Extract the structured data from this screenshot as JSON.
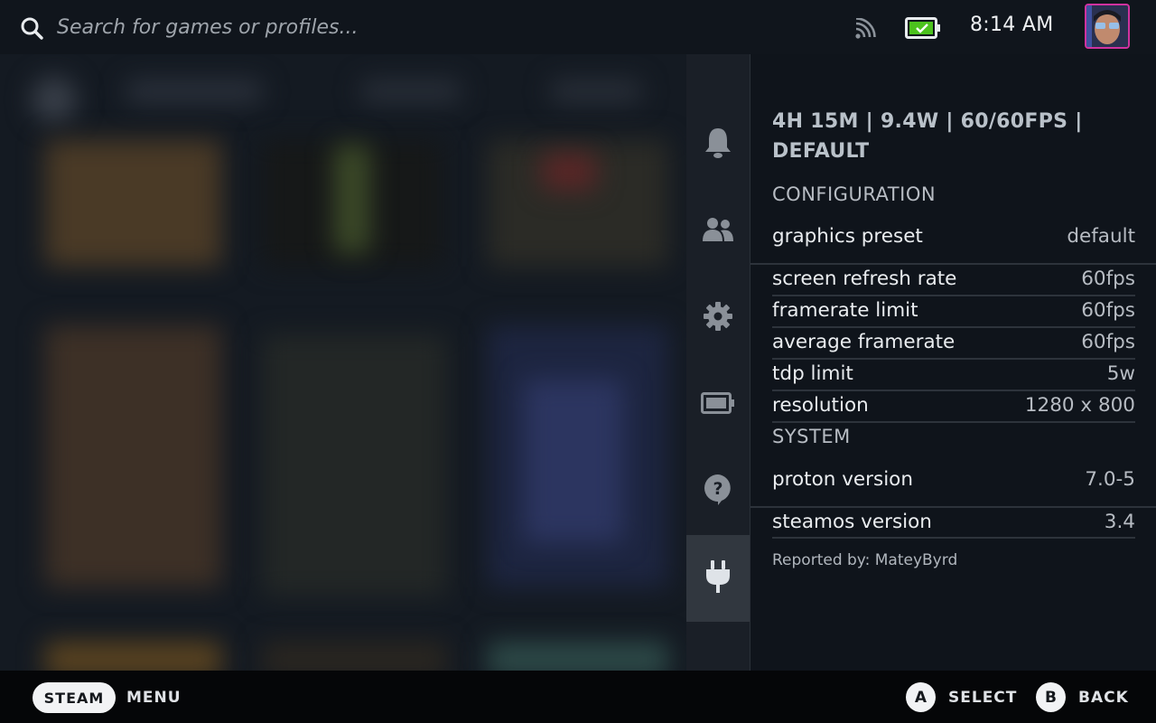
{
  "search": {
    "placeholder": "Search for games or profiles..."
  },
  "status": {
    "clock": "8:14 AM"
  },
  "icons": {
    "search": "search-icon",
    "cast": "rss-icon",
    "battery": "battery-charging-icon",
    "tabs": [
      "bell-icon",
      "friends-icon",
      "gear-icon",
      "battery-icon",
      "help-icon",
      "plug-icon"
    ]
  },
  "panel": {
    "summary": "4H 15M | 9.4W | 60/60FPS | DEFAULT",
    "configuration_header": "CONFIGURATION",
    "configuration": [
      {
        "label": "graphics preset",
        "value": "default"
      },
      {
        "label": "screen refresh rate",
        "value": "60fps"
      },
      {
        "label": "framerate limit",
        "value": "60fps"
      },
      {
        "label": "average framerate",
        "value": "60fps"
      },
      {
        "label": "tdp limit",
        "value": "5w"
      },
      {
        "label": "resolution",
        "value": "1280 x 800"
      }
    ],
    "system_header": "SYSTEM",
    "system": [
      {
        "label": "proton version",
        "value": "7.0-5"
      },
      {
        "label": "steamos version",
        "value": "3.4"
      }
    ],
    "reporter": "Reported by: MateyByrd"
  },
  "footer": {
    "steam_label": "STEAM",
    "menu_label": "MENU",
    "a_key": "A",
    "select_label": "SELECT",
    "b_key": "B",
    "back_label": "BACK"
  },
  "colors": {
    "background": "#131820",
    "panel": "#0f141b",
    "tab_active": "#31373f",
    "battery_fill": "#4cc21d",
    "avatar_border": "#d0329f"
  }
}
